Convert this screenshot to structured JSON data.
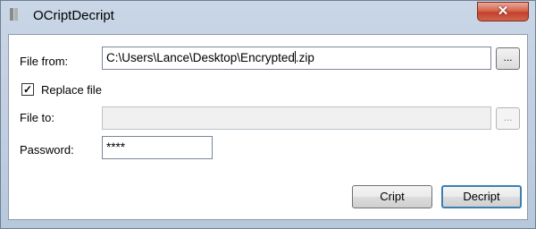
{
  "window": {
    "title": "OCriptDecript",
    "close_glyph": "✕",
    "icon": "app-icon"
  },
  "form": {
    "file_from": {
      "label": "File from:",
      "value_before_caret": "C:\\Users\\Lance\\Desktop\\Encrypted",
      "value_after_caret": ".zip",
      "browse_label": "..."
    },
    "replace_file": {
      "label": "Replace file",
      "checked": true,
      "check_glyph": "✓"
    },
    "file_to": {
      "label": "File to:",
      "value": "",
      "enabled": false,
      "browse_label": "..."
    },
    "password": {
      "label": "Password:",
      "value": "****"
    }
  },
  "actions": {
    "cript_label": "Cript",
    "decript_label": "Decript"
  }
}
